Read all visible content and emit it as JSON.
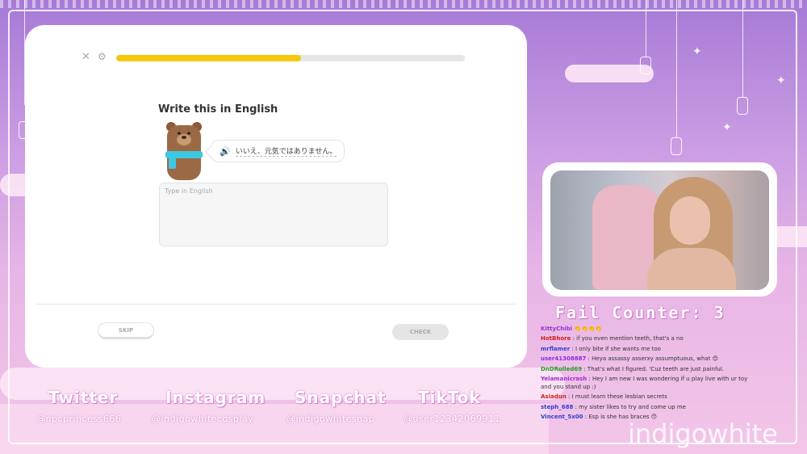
{
  "app": {
    "close_icon": "close-icon",
    "settings_icon": "gear-icon",
    "progress": 0.53,
    "prompt": "Write this in English",
    "sentence": "いいえ、元気ではありません。",
    "answer_placeholder": "Type in English",
    "skip_label": "SKIP",
    "check_label": "CHECK",
    "colors": {
      "progress": "#f5c80f",
      "speaker": "#1cb0f6",
      "scarf": "#3ec7e0"
    }
  },
  "overlay": {
    "fail_counter": "Fail Counter: 3",
    "watermark": "indigowhite",
    "socials": [
      {
        "platform": "Twitter",
        "handle": "@npcprincess666"
      },
      {
        "platform": "Instagram",
        "handle": "@indigowhitecosplay"
      },
      {
        "platform": "Snapchat",
        "handle": "@indigowhitesnap"
      },
      {
        "platform": "TikTok",
        "handle": "@user12342069911"
      }
    ],
    "chat": [
      {
        "user": "KittyChibi",
        "color": "#9b30d0",
        "message": "👏👏👏👏"
      },
      {
        "user": "HotBhore",
        "color": "#d02020",
        "message": ": if you even mention teeth, that's a no"
      },
      {
        "user": "mrflamer",
        "color": "#3040d0",
        "message": ": I only bite if she wants me too"
      },
      {
        "user": "user41308887",
        "color": "#8a2be2",
        "message": ": Heya assassy asserxy assumptuous, what 😊"
      },
      {
        "user": "DnDRolled69",
        "color": "#20a020",
        "message": ": That's what I figured. 'Cuz teeth are just painful."
      },
      {
        "user": "Yelamanicrash",
        "color": "#9b30d0",
        "message": ": Hey I am new I was wondering if u play live with ur toy and you stand up :)"
      },
      {
        "user": "Asiadun",
        "color": "#d02020",
        "message": ": I must learn these lesbian secrets"
      },
      {
        "user": "steph_688",
        "color": "#3040d0",
        "message": ": my sister likes to try and come up me"
      },
      {
        "user": "Vincent_5x00",
        "color": "#3040d0",
        "message": ": Esp is she has braces 😯"
      }
    ]
  }
}
